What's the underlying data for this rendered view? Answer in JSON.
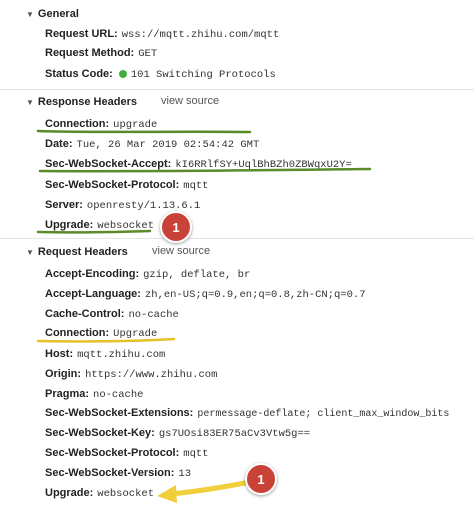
{
  "general": {
    "title": "General",
    "rows": [
      {
        "key": "Request URL:",
        "value": "wss://mqtt.zhihu.com/mqtt"
      },
      {
        "key": "Request Method:",
        "value": "GET"
      },
      {
        "key": "Status Code:",
        "value": "101 Switching Protocols"
      }
    ]
  },
  "response": {
    "title": "Response Headers",
    "view_source": "view source",
    "rows": [
      {
        "key": "Connection:",
        "value": "upgrade"
      },
      {
        "key": "Date:",
        "value": "Tue, 26 Mar 2019 02:54:42 GMT"
      },
      {
        "key": "Sec-WebSocket-Accept:",
        "value": "kI6RRlfSY+UqlBhBZh0ZBWqxU2Y="
      },
      {
        "key": "Sec-WebSocket-Protocol:",
        "value": "mqtt"
      },
      {
        "key": "Server:",
        "value": "openresty/1.13.6.1"
      },
      {
        "key": "Upgrade:",
        "value": "websocket"
      }
    ]
  },
  "request": {
    "title": "Request Headers",
    "view_source": "view source",
    "rows": [
      {
        "key": "Accept-Encoding:",
        "value": "gzip, deflate, br"
      },
      {
        "key": "Accept-Language:",
        "value": "zh,en-US;q=0.9,en;q=0.8,zh-CN;q=0.7"
      },
      {
        "key": "Cache-Control:",
        "value": "no-cache"
      },
      {
        "key": "Connection:",
        "value": "Upgrade"
      },
      {
        "key": "Host:",
        "value": "mqtt.zhihu.com"
      },
      {
        "key": "Origin:",
        "value": "https://www.zhihu.com"
      },
      {
        "key": "Pragma:",
        "value": "no-cache"
      },
      {
        "key": "Sec-WebSocket-Extensions:",
        "value": "permessage-deflate; client_max_window_bits"
      },
      {
        "key": "Sec-WebSocket-Key:",
        "value": "gs7UOsi83ER75aCv3Vtw5g=="
      },
      {
        "key": "Sec-WebSocket-Protocol:",
        "value": "mqtt"
      },
      {
        "key": "Sec-WebSocket-Version:",
        "value": "13"
      },
      {
        "key": "Upgrade:",
        "value": "websocket"
      }
    ]
  },
  "badges": {
    "first": "1",
    "second": "1"
  },
  "colors": {
    "status_dot": "#3fae3f",
    "highlight_green": "#5a8a2a",
    "highlight_yellow": "#e6c229",
    "badge_red": "#c94237",
    "arrow_yellow": "#f0cf3a"
  },
  "icons": {
    "section_toggle": "triangle-down-icon",
    "status": "status-dot-icon"
  }
}
